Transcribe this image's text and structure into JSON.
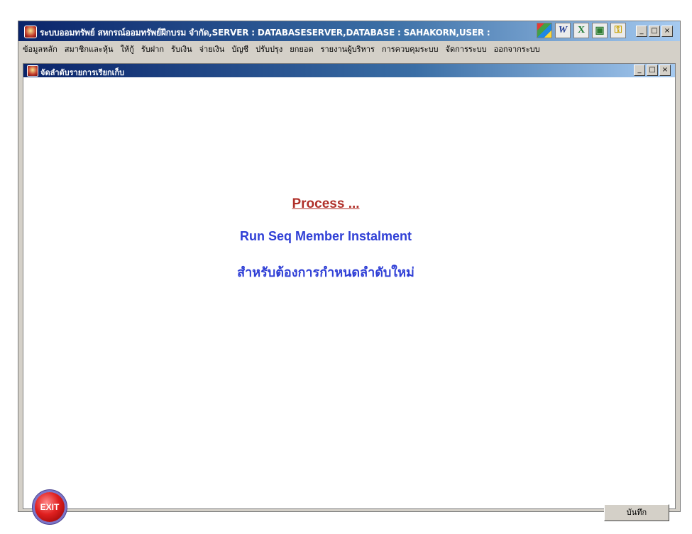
{
  "window": {
    "title": "ระบบออมทรัพย์ สหกรณ์ออมทรัพย์ฝึกบรม จำกัด,SERVER : DATABASESERVER,DATABASE : SAHAKORN,USER :"
  },
  "toolbar_icons": [
    {
      "name": "color-palette-icon",
      "glyph": "▦"
    },
    {
      "name": "word-icon",
      "glyph": "W"
    },
    {
      "name": "excel-icon",
      "glyph": "X"
    },
    {
      "name": "image-icon",
      "glyph": "▣"
    },
    {
      "name": "key-icon",
      "glyph": "⚿"
    }
  ],
  "menu": [
    "ข้อมูลหลัก",
    "สมาชิกและหุ้น",
    "ให้กู้",
    "รับฝาก",
    "รับเงิน",
    "จ่ายเงิน",
    "บัญชี",
    "ปรับปรุง",
    "ยกยอด",
    "รายงานผู้บริหาร",
    "การควบคุมระบบ",
    "จัดการระบบ",
    "ออกจากระบบ"
  ],
  "child_window": {
    "title": "จัดลำดับรายการเรียกเก็บ"
  },
  "content": {
    "process": "Process ...",
    "run_seq": "Run Seq Member Instalment",
    "thai_note": "สำหรับต้องการกำหนดลำดับใหม่"
  },
  "buttons": {
    "exit": "EXIT",
    "save": "บันทึก"
  },
  "controls": {
    "minimize": "_",
    "maximize": "□",
    "close": "×"
  }
}
